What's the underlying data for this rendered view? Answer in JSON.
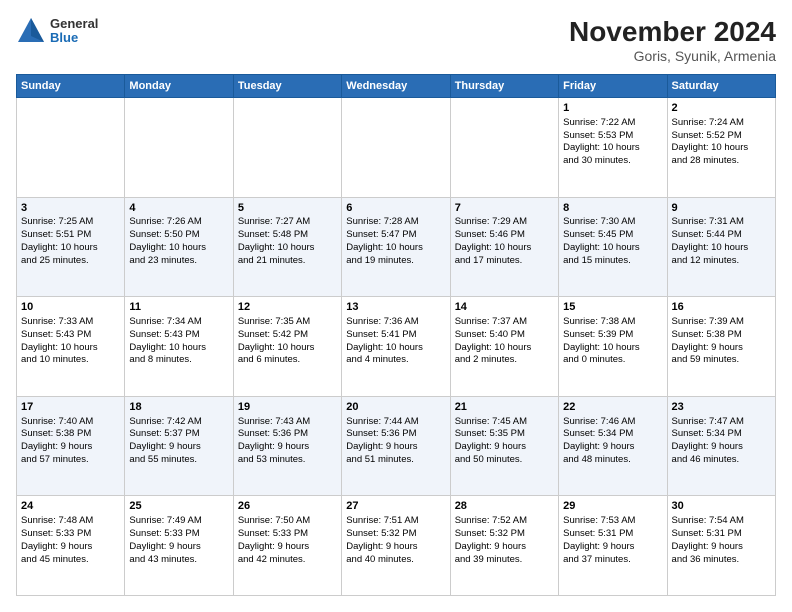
{
  "header": {
    "logo_line1": "General",
    "logo_line2": "Blue",
    "title": "November 2024",
    "subtitle": "Goris, Syunik, Armenia"
  },
  "days_of_week": [
    "Sunday",
    "Monday",
    "Tuesday",
    "Wednesday",
    "Thursday",
    "Friday",
    "Saturday"
  ],
  "weeks": [
    [
      {
        "day": "",
        "info": ""
      },
      {
        "day": "",
        "info": ""
      },
      {
        "day": "",
        "info": ""
      },
      {
        "day": "",
        "info": ""
      },
      {
        "day": "",
        "info": ""
      },
      {
        "day": "1",
        "info": "Sunrise: 7:22 AM\nSunset: 5:53 PM\nDaylight: 10 hours\nand 30 minutes."
      },
      {
        "day": "2",
        "info": "Sunrise: 7:24 AM\nSunset: 5:52 PM\nDaylight: 10 hours\nand 28 minutes."
      }
    ],
    [
      {
        "day": "3",
        "info": "Sunrise: 7:25 AM\nSunset: 5:51 PM\nDaylight: 10 hours\nand 25 minutes."
      },
      {
        "day": "4",
        "info": "Sunrise: 7:26 AM\nSunset: 5:50 PM\nDaylight: 10 hours\nand 23 minutes."
      },
      {
        "day": "5",
        "info": "Sunrise: 7:27 AM\nSunset: 5:48 PM\nDaylight: 10 hours\nand 21 minutes."
      },
      {
        "day": "6",
        "info": "Sunrise: 7:28 AM\nSunset: 5:47 PM\nDaylight: 10 hours\nand 19 minutes."
      },
      {
        "day": "7",
        "info": "Sunrise: 7:29 AM\nSunset: 5:46 PM\nDaylight: 10 hours\nand 17 minutes."
      },
      {
        "day": "8",
        "info": "Sunrise: 7:30 AM\nSunset: 5:45 PM\nDaylight: 10 hours\nand 15 minutes."
      },
      {
        "day": "9",
        "info": "Sunrise: 7:31 AM\nSunset: 5:44 PM\nDaylight: 10 hours\nand 12 minutes."
      }
    ],
    [
      {
        "day": "10",
        "info": "Sunrise: 7:33 AM\nSunset: 5:43 PM\nDaylight: 10 hours\nand 10 minutes."
      },
      {
        "day": "11",
        "info": "Sunrise: 7:34 AM\nSunset: 5:43 PM\nDaylight: 10 hours\nand 8 minutes."
      },
      {
        "day": "12",
        "info": "Sunrise: 7:35 AM\nSunset: 5:42 PM\nDaylight: 10 hours\nand 6 minutes."
      },
      {
        "day": "13",
        "info": "Sunrise: 7:36 AM\nSunset: 5:41 PM\nDaylight: 10 hours\nand 4 minutes."
      },
      {
        "day": "14",
        "info": "Sunrise: 7:37 AM\nSunset: 5:40 PM\nDaylight: 10 hours\nand 2 minutes."
      },
      {
        "day": "15",
        "info": "Sunrise: 7:38 AM\nSunset: 5:39 PM\nDaylight: 10 hours\nand 0 minutes."
      },
      {
        "day": "16",
        "info": "Sunrise: 7:39 AM\nSunset: 5:38 PM\nDaylight: 9 hours\nand 59 minutes."
      }
    ],
    [
      {
        "day": "17",
        "info": "Sunrise: 7:40 AM\nSunset: 5:38 PM\nDaylight: 9 hours\nand 57 minutes."
      },
      {
        "day": "18",
        "info": "Sunrise: 7:42 AM\nSunset: 5:37 PM\nDaylight: 9 hours\nand 55 minutes."
      },
      {
        "day": "19",
        "info": "Sunrise: 7:43 AM\nSunset: 5:36 PM\nDaylight: 9 hours\nand 53 minutes."
      },
      {
        "day": "20",
        "info": "Sunrise: 7:44 AM\nSunset: 5:36 PM\nDaylight: 9 hours\nand 51 minutes."
      },
      {
        "day": "21",
        "info": "Sunrise: 7:45 AM\nSunset: 5:35 PM\nDaylight: 9 hours\nand 50 minutes."
      },
      {
        "day": "22",
        "info": "Sunrise: 7:46 AM\nSunset: 5:34 PM\nDaylight: 9 hours\nand 48 minutes."
      },
      {
        "day": "23",
        "info": "Sunrise: 7:47 AM\nSunset: 5:34 PM\nDaylight: 9 hours\nand 46 minutes."
      }
    ],
    [
      {
        "day": "24",
        "info": "Sunrise: 7:48 AM\nSunset: 5:33 PM\nDaylight: 9 hours\nand 45 minutes."
      },
      {
        "day": "25",
        "info": "Sunrise: 7:49 AM\nSunset: 5:33 PM\nDaylight: 9 hours\nand 43 minutes."
      },
      {
        "day": "26",
        "info": "Sunrise: 7:50 AM\nSunset: 5:33 PM\nDaylight: 9 hours\nand 42 minutes."
      },
      {
        "day": "27",
        "info": "Sunrise: 7:51 AM\nSunset: 5:32 PM\nDaylight: 9 hours\nand 40 minutes."
      },
      {
        "day": "28",
        "info": "Sunrise: 7:52 AM\nSunset: 5:32 PM\nDaylight: 9 hours\nand 39 minutes."
      },
      {
        "day": "29",
        "info": "Sunrise: 7:53 AM\nSunset: 5:31 PM\nDaylight: 9 hours\nand 37 minutes."
      },
      {
        "day": "30",
        "info": "Sunrise: 7:54 AM\nSunset: 5:31 PM\nDaylight: 9 hours\nand 36 minutes."
      }
    ]
  ]
}
